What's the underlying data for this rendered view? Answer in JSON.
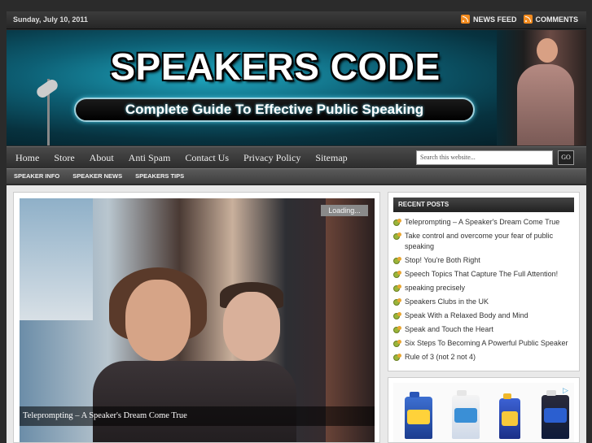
{
  "topbar": {
    "date": "Sunday, July 10, 2011",
    "news_feed": "NEWS FEED",
    "comments": "COMMENTS"
  },
  "header": {
    "title": "SPEAKERS CODE",
    "tagline": "Complete Guide To Effective Public Speaking"
  },
  "nav": {
    "items": [
      "Home",
      "Store",
      "About",
      "Anti Spam",
      "Contact Us",
      "Privacy Policy",
      "Sitemap"
    ],
    "search_placeholder": "Search this website...",
    "search_button": "GO"
  },
  "subnav": {
    "items": [
      "SPEAKER INFO",
      "SPEAKER NEWS",
      "SPEAKERS TIPS"
    ]
  },
  "slider": {
    "loading": "Loading...",
    "caption": "Teleprompting – A Speaker's Dream Come True"
  },
  "sidebar": {
    "recent_title": "RECENT POSTS",
    "posts": [
      "Teleprompting – A Speaker's Dream Come True",
      "Take control and overcome your fear of public speaking",
      "Stop! You're Both Right",
      "Speech Topics That Capture The Full Attention!",
      "speaking precisely",
      "Speakers Clubs in the UK",
      "Speak With a Relaxed Body and Mind",
      "Speak and Touch the Heart",
      "Six Steps To Becoming A Powerful Public Speaker",
      "Rule of 3 (not 2 not 4)"
    ]
  },
  "colors": {
    "banner_accent": "#1fa7c0",
    "nav_bg": "#333333",
    "rss": "#f28b1f"
  },
  "icons": {
    "rss": "rss-icon",
    "post_bullet": "bullet-icon",
    "ad_choices": "adchoices-icon"
  }
}
